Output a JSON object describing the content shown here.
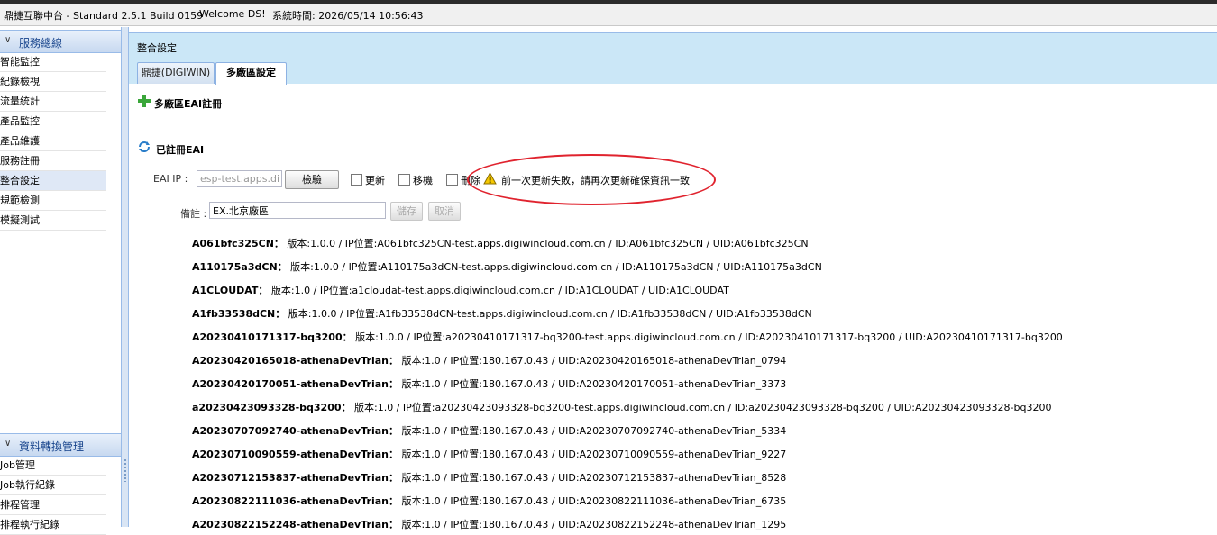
{
  "window": {
    "app_title": "鼎捷互聯中台 - Standard 2.5.1 Build 0159",
    "welcome": "Welcome DS!",
    "system_time": "系統時間: 2026/05/14 10:56:43"
  },
  "sidebar": {
    "panel1": {
      "title": "服務總線",
      "items": [
        "智能監控",
        "紀錄檢視",
        "流量統計",
        "產品監控",
        "產品維護",
        "服務註冊",
        "整合設定",
        "規範檢測",
        "模擬測試"
      ],
      "selected": "整合設定"
    },
    "panel2": {
      "title": "資料轉換管理",
      "items": [
        "Job管理",
        "Job執行紀錄",
        "排程管理",
        "排程執行紀錄"
      ]
    }
  },
  "main": {
    "title": "整合設定",
    "tabs": [
      {
        "label": "鼎捷(DIGIWIN)",
        "active": false
      },
      {
        "label": "多廠區設定",
        "active": true
      }
    ],
    "register_section": "多廠區EAI註冊",
    "registered_section": "已註冊EAI",
    "form": {
      "eai_ip_label": "EAI IP :",
      "eai_ip_value": "esp-test.apps.digiwincloud.com.cn",
      "check_button": "檢驗",
      "update_label": "更新",
      "move_label": "移機",
      "delete_label": "刪除",
      "warning_text": "前一次更新失敗，請再次更新確保資訊一致",
      "note_label": "備註 :",
      "note_placeholder": "EX.北京廠區",
      "save_button": "儲存",
      "cancel_button": "取消"
    },
    "entries": [
      {
        "name": "A061bfc325CN：",
        "detail": "版本:1.0.0 / IP位置:A061bfc325CN-test.apps.digiwincloud.com.cn / ID:A061bfc325CN / UID:A061bfc325CN"
      },
      {
        "name": "A110175a3dCN：",
        "detail": "版本:1.0.0 / IP位置:A110175a3dCN-test.apps.digiwincloud.com.cn / ID:A110175a3dCN / UID:A110175a3dCN"
      },
      {
        "name": "A1CLOUDAT：",
        "detail": "版本:1.0 / IP位置:a1cloudat-test.apps.digiwincloud.com.cn / ID:A1CLOUDAT / UID:A1CLOUDAT"
      },
      {
        "name": "A1fb33538dCN：",
        "detail": "版本:1.0.0 / IP位置:A1fb33538dCN-test.apps.digiwincloud.com.cn / ID:A1fb33538dCN / UID:A1fb33538dCN"
      },
      {
        "name": "A20230410171317-bq3200：",
        "detail": "版本:1.0.0 / IP位置:a20230410171317-bq3200-test.apps.digiwincloud.com.cn / ID:A20230410171317-bq3200 / UID:A20230410171317-bq3200"
      },
      {
        "name": "A20230420165018-athenaDevTrian：",
        "detail": "版本:1.0 / IP位置:180.167.0.43 / UID:A20230420165018-athenaDevTrian_0794"
      },
      {
        "name": "A20230420170051-athenaDevTrian：",
        "detail": "版本:1.0 / IP位置:180.167.0.43 / UID:A20230420170051-athenaDevTrian_3373"
      },
      {
        "name": "a20230423093328-bq3200：",
        "detail": "版本:1.0 / IP位置:a20230423093328-bq3200-test.apps.digiwincloud.com.cn / ID:a20230423093328-bq3200 / UID:A20230423093328-bq3200"
      },
      {
        "name": "A20230707092740-athenaDevTrian：",
        "detail": "版本:1.0 / IP位置:180.167.0.43 / UID:A20230707092740-athenaDevTrian_5334"
      },
      {
        "name": "A20230710090559-athenaDevTrian：",
        "detail": "版本:1.0 / IP位置:180.167.0.43 / UID:A20230710090559-athenaDevTrian_9227"
      },
      {
        "name": "A20230712153837-athenaDevTrian：",
        "detail": "版本:1.0 / IP位置:180.167.0.43 / UID:A20230712153837-athenaDevTrian_8528"
      },
      {
        "name": "A20230822111036-athenaDevTrian：",
        "detail": "版本:1.0 / IP位置:180.167.0.43 / UID:A20230822111036-athenaDevTrian_6735"
      },
      {
        "name": "A20230822152248-athenaDevTrian：",
        "detail": "版本:1.0 / IP位置:180.167.0.43 / UID:A20230822152248-athenaDevTrian_1295"
      }
    ]
  }
}
